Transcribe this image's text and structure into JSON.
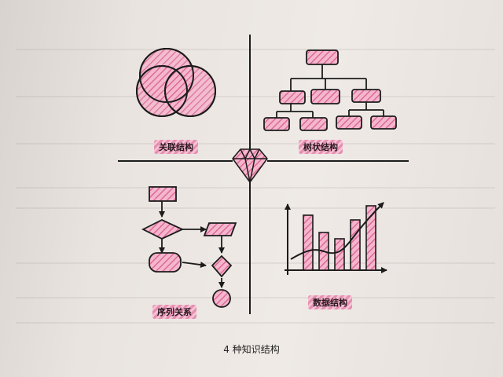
{
  "quadrants": {
    "relation": {
      "label": "关联结构"
    },
    "tree": {
      "label": "树状结构"
    },
    "sequence": {
      "label": "序列关系"
    },
    "data": {
      "label": "数据结构"
    }
  },
  "caption": "4 种知识结构",
  "colors": {
    "pink_fill": "#f1a7c2",
    "pink_stripe": "#d9608f",
    "ink": "#1c1c1c"
  },
  "icons": {
    "center": "diamond-gem-icon"
  }
}
